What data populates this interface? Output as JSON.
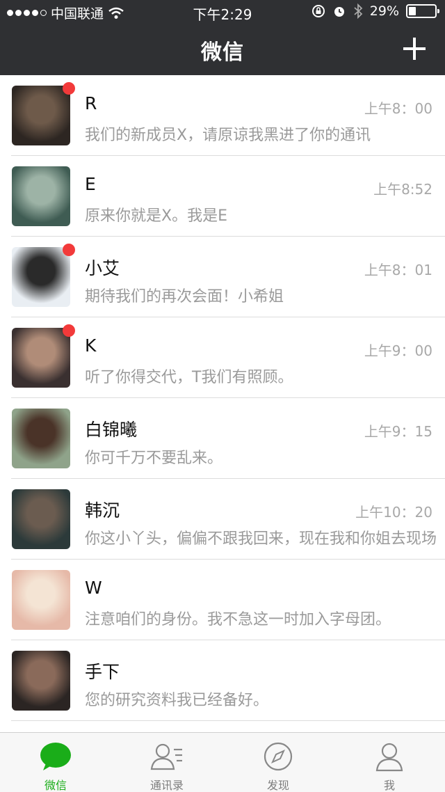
{
  "status_bar": {
    "carrier": "中国联通",
    "time": "下午2:29",
    "battery": "29%",
    "battery_level": 0.29
  },
  "nav": {
    "title": "微信",
    "add_icon": "plus-icon"
  },
  "chats": [
    {
      "name": "R",
      "time": "上午8：00",
      "preview": "我们的新成员X，请原谅我黑进了你的通讯",
      "unread": true,
      "avatar_colors": [
        "#2d2622",
        "#6e5a4a"
      ]
    },
    {
      "name": "E",
      "time": "上午8:52",
      "preview": "原来你就是X。我是E",
      "unread": false,
      "avatar_colors": [
        "#3f5c53",
        "#9db3a6"
      ]
    },
    {
      "name": "小艾",
      "time": "上午8：01",
      "preview": "期待我们的再次会面！小希姐",
      "unread": true,
      "avatar_colors": [
        "#e9eef3",
        "#2a2a2a"
      ]
    },
    {
      "name": "K",
      "time": "上午9：00",
      "preview": "听了你得交代，T我们有照顾。",
      "unread": true,
      "avatar_colors": [
        "#3a3030",
        "#b08c78"
      ]
    },
    {
      "name": "白锦曦",
      "time": "上午9：15",
      "preview": "你可千万不要乱来。",
      "unread": false,
      "avatar_colors": [
        "#8fa38a",
        "#4a3328"
      ]
    },
    {
      "name": "韩沉",
      "time": "上午10：20",
      "preview": "你这小丫头，偏偏不跟我回来，现在我和你姐去现场",
      "unread": false,
      "avatar_colors": [
        "#2c3a3a",
        "#6b5c50"
      ]
    },
    {
      "name": "W",
      "time": "",
      "preview": "注意咱们的身份。我不急这一时加入字母团。",
      "unread": false,
      "avatar_colors": [
        "#e6b9a8",
        "#f4e4d4"
      ]
    },
    {
      "name": "手下",
      "time": "",
      "preview": "您的研究资料我已经备好。",
      "unread": false,
      "avatar_colors": [
        "#2b2523",
        "#8a6a5a"
      ]
    }
  ],
  "tabs": [
    {
      "label": "微信",
      "icon": "chat-bubble-icon",
      "active": true
    },
    {
      "label": "通讯录",
      "icon": "contacts-icon",
      "active": false
    },
    {
      "label": "发现",
      "icon": "compass-icon",
      "active": false
    },
    {
      "label": "我",
      "icon": "person-icon",
      "active": false
    }
  ],
  "colors": {
    "topbar": "#2f3033",
    "accent": "#1aad19",
    "unread": "#f23a3a"
  }
}
